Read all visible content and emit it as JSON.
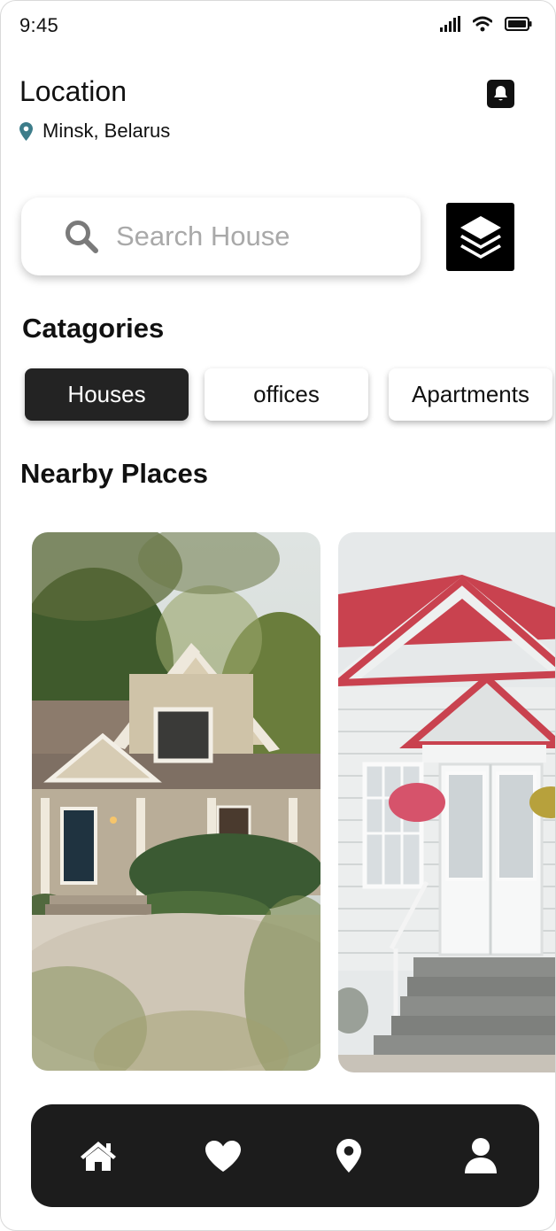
{
  "status_bar": {
    "time": "9:45"
  },
  "location": {
    "title": "Location",
    "city": "Minsk, Belarus"
  },
  "search": {
    "placeholder": "Search House",
    "value": ""
  },
  "categories": {
    "title": "Catagories",
    "items": [
      {
        "label": "Houses",
        "active": true
      },
      {
        "label": "offices",
        "active": false
      },
      {
        "label": "Apartments",
        "active": false
      }
    ]
  },
  "nearby": {
    "title": "Nearby Places"
  },
  "bottom_nav": {
    "items": [
      {
        "icon": "home-icon"
      },
      {
        "icon": "heart-icon"
      },
      {
        "icon": "map-pin-icon"
      },
      {
        "icon": "user-icon"
      }
    ]
  },
  "colors": {
    "accent": "#1c1c1c",
    "pin": "#3d7d8a",
    "chip_active": "#232323"
  }
}
